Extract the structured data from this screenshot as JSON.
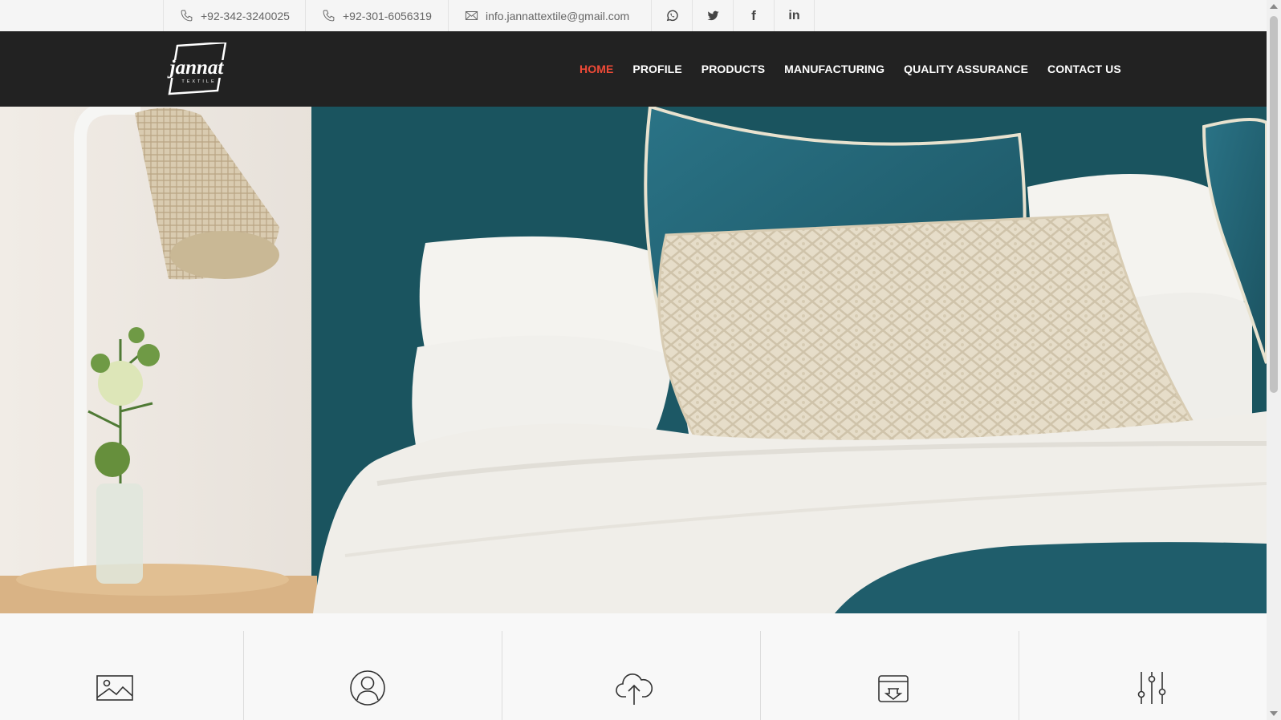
{
  "topbar": {
    "phone1": "+92-342-3240025",
    "phone2": "+92-301-6056319",
    "email": "info.jannattextile@gmail.com",
    "social": [
      {
        "icon": "whatsapp-icon"
      },
      {
        "icon": "twitter-icon"
      },
      {
        "icon": "facebook-icon",
        "glyph": "f"
      },
      {
        "icon": "linkedin-icon",
        "glyph": "in"
      }
    ]
  },
  "logo": {
    "name": "jannat",
    "tagline": "TEXTILE"
  },
  "nav": {
    "items": [
      {
        "label": "HOME",
        "active": true
      },
      {
        "label": "PROFILE"
      },
      {
        "label": "PRODUCTS"
      },
      {
        "label": "MANUFACTURING"
      },
      {
        "label": "QUALITY ASSURANCE"
      },
      {
        "label": "CONTACT US"
      }
    ],
    "active_color": "#ef4a37"
  },
  "hero": {
    "image": "bedroom-bedding-photo"
  },
  "features": {
    "icons": [
      "image-icon",
      "user-icon",
      "cloud-upload-icon",
      "archive-download-icon",
      "sliders-icon"
    ]
  },
  "colors": {
    "nav_bg": "#222222",
    "accent": "#ef4a37",
    "teal": "#1c5865"
  }
}
